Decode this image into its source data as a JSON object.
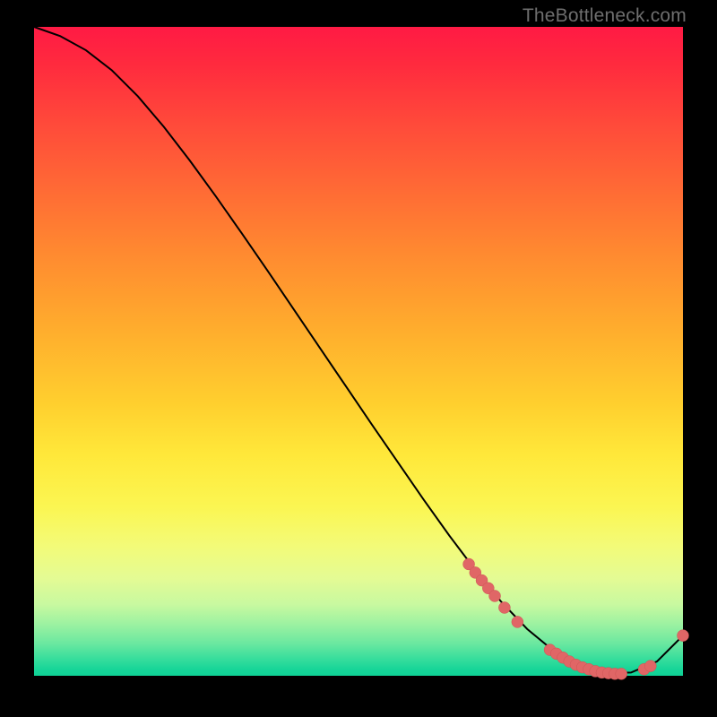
{
  "watermark": "TheBottleneck.com",
  "colors": {
    "curve_stroke": "#000000",
    "marker_fill": "#e06666",
    "marker_stroke": "#cc5555"
  },
  "chart_data": {
    "type": "line",
    "title": "",
    "xlabel": "",
    "ylabel": "",
    "xlim": [
      0,
      100
    ],
    "ylim": [
      0,
      100
    ],
    "grid": false,
    "series": [
      {
        "name": "curve",
        "x": [
          0,
          4,
          8,
          12,
          16,
          20,
          24,
          28,
          32,
          36,
          40,
          44,
          48,
          52,
          56,
          60,
          64,
          68,
          72,
          76,
          80,
          84,
          88,
          92,
          96,
          100
        ],
        "y": [
          100,
          98.6,
          96.4,
          93.3,
          89.3,
          84.6,
          79.4,
          73.9,
          68.2,
          62.4,
          56.5,
          50.6,
          44.7,
          38.8,
          33.0,
          27.2,
          21.6,
          16.3,
          11.4,
          7.2,
          3.9,
          1.6,
          0.4,
          0.5,
          2.2,
          6.2
        ]
      }
    ],
    "markers": [
      {
        "x": 67,
        "y": 17.2
      },
      {
        "x": 68,
        "y": 15.9
      },
      {
        "x": 69,
        "y": 14.7
      },
      {
        "x": 70,
        "y": 13.5
      },
      {
        "x": 71,
        "y": 12.3
      },
      {
        "x": 72.5,
        "y": 10.5
      },
      {
        "x": 74.5,
        "y": 8.3
      },
      {
        "x": 79.5,
        "y": 4.0
      },
      {
        "x": 80.5,
        "y": 3.4
      },
      {
        "x": 81.5,
        "y": 2.8
      },
      {
        "x": 82.5,
        "y": 2.2
      },
      {
        "x": 83.5,
        "y": 1.7
      },
      {
        "x": 84.5,
        "y": 1.3
      },
      {
        "x": 85.5,
        "y": 1.0
      },
      {
        "x": 86.5,
        "y": 0.7
      },
      {
        "x": 87.5,
        "y": 0.5
      },
      {
        "x": 88.5,
        "y": 0.4
      },
      {
        "x": 89.5,
        "y": 0.3
      },
      {
        "x": 90.5,
        "y": 0.3
      },
      {
        "x": 94.0,
        "y": 1.0
      },
      {
        "x": 95.0,
        "y": 1.5
      },
      {
        "x": 100.0,
        "y": 6.2
      }
    ]
  }
}
